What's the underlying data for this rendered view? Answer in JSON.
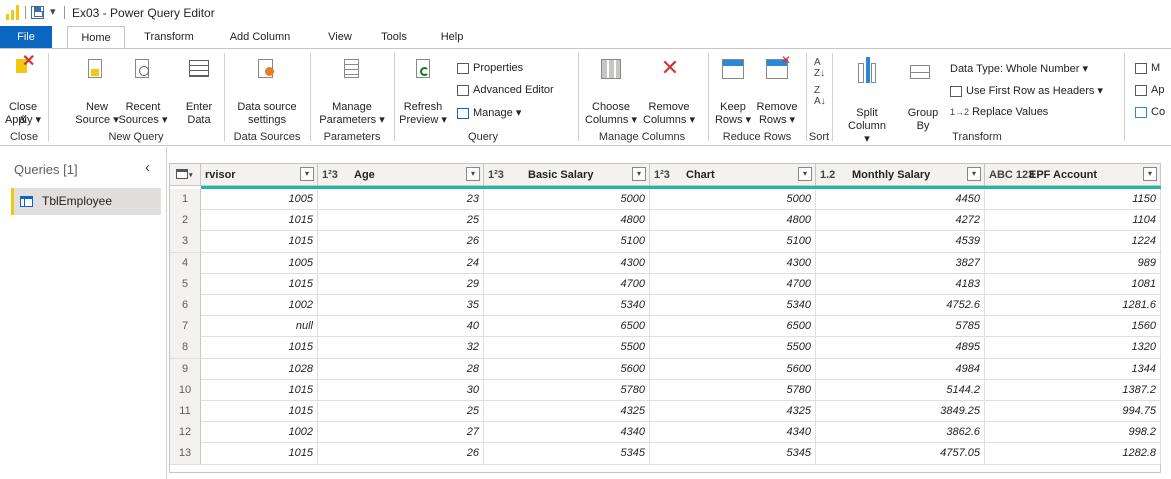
{
  "window": {
    "title": "Ex03 - Power Query Editor"
  },
  "tabs": [
    "File",
    "Home",
    "Transform",
    "Add Column",
    "View",
    "Tools",
    "Help"
  ],
  "ribbon": {
    "close": {
      "btn": "Close &",
      "btn2": "Apply",
      "group": "Close"
    },
    "new_query": {
      "new": "New",
      "new2": "Source",
      "recent": "Recent",
      "recent2": "Sources",
      "enter": "Enter",
      "enter2": "Data",
      "group": "New Query"
    },
    "data_sources": {
      "btn": "Data source",
      "btn2": "settings",
      "group": "Data Sources"
    },
    "parameters": {
      "btn": "Manage",
      "btn2": "Parameters",
      "group": "Parameters"
    },
    "query": {
      "refresh": "Refresh",
      "refresh2": "Preview",
      "properties": "Properties",
      "advanced": "Advanced Editor",
      "manage": "Manage",
      "group": "Query"
    },
    "manage_columns": {
      "choose": "Choose",
      "choose2": "Columns",
      "remove": "Remove",
      "remove2": "Columns",
      "group": "Manage Columns"
    },
    "reduce_rows": {
      "keep": "Keep",
      "keep2": "Rows",
      "remove": "Remove",
      "remove2": "Rows",
      "group": "Reduce Rows"
    },
    "sort": {
      "group": "Sort"
    },
    "transform": {
      "split": "Split",
      "split2": "Column",
      "group_by": "Group",
      "group_by2": "By",
      "data_type": "Data Type: Whole Number",
      "first_row": "Use First Row as Headers",
      "replace": "Replace Values",
      "group": "Transform"
    },
    "overflow": {
      "a": "M",
      "b": "Ap",
      "c": "Co"
    }
  },
  "queries": {
    "title": "Queries [1]",
    "items": [
      "TblEmployee"
    ]
  },
  "grid": {
    "columns": [
      {
        "type": "",
        "name": "rvisor"
      },
      {
        "type": "1²3",
        "name": "Age"
      },
      {
        "type": "1²3",
        "name": "Basic Salary"
      },
      {
        "type": "1²3",
        "name": "Chart"
      },
      {
        "type": "1.2",
        "name": "Monthly Salary"
      },
      {
        "type": "ABC 123",
        "name": "EPF Account"
      }
    ],
    "rows": [
      [
        "1",
        "1005",
        "23",
        "5000",
        "5000",
        "4450",
        "1150"
      ],
      [
        "2",
        "1015",
        "25",
        "4800",
        "4800",
        "4272",
        "1104"
      ],
      [
        "3",
        "1015",
        "26",
        "5100",
        "5100",
        "4539",
        "1224"
      ],
      [
        "4",
        "1005",
        "24",
        "4300",
        "4300",
        "3827",
        "989"
      ],
      [
        "5",
        "1015",
        "29",
        "4700",
        "4700",
        "4183",
        "1081"
      ],
      [
        "6",
        "1002",
        "35",
        "5340",
        "5340",
        "4752.6",
        "1281.6"
      ],
      [
        "7",
        "null",
        "40",
        "6500",
        "6500",
        "5785",
        "1560"
      ],
      [
        "8",
        "1015",
        "32",
        "5500",
        "5500",
        "4895",
        "1320"
      ],
      [
        "9",
        "1028",
        "28",
        "5600",
        "5600",
        "4984",
        "1344"
      ],
      [
        "10",
        "1015",
        "30",
        "5780",
        "5780",
        "5144.2",
        "1387.2"
      ],
      [
        "11",
        "1015",
        "25",
        "4325",
        "4325",
        "3849.25",
        "994.75"
      ],
      [
        "12",
        "1002",
        "27",
        "4340",
        "4340",
        "3862.6",
        "998.2"
      ],
      [
        "13",
        "1015",
        "26",
        "5345",
        "5345",
        "4757.05",
        "1282.8"
      ]
    ]
  },
  "colors": {
    "file_tab": "#0b66c2",
    "quality_bar": "#1eb8a4",
    "accent": "#f2c811"
  }
}
